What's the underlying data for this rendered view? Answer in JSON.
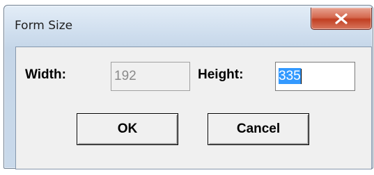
{
  "window": {
    "title": "Form Size"
  },
  "form": {
    "width_label": "Width:",
    "width_value": "192",
    "height_label": "Height:",
    "height_value": "335"
  },
  "buttons": {
    "ok_label": "OK",
    "cancel_label": "Cancel"
  },
  "icons": {
    "close": "close-icon"
  }
}
